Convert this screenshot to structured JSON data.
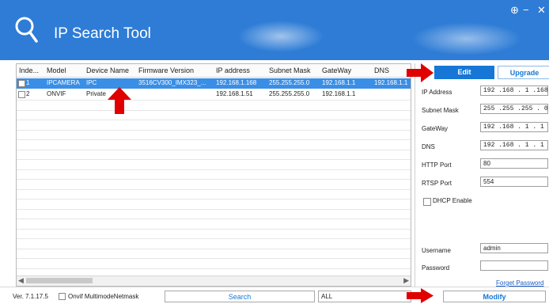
{
  "header": {
    "title": "IP Search Tool",
    "settings_label": "⊕",
    "minimize_label": "−",
    "close_label": "✕"
  },
  "table": {
    "columns": [
      "Inde...",
      "Model",
      "Device Name",
      "Firmware Version",
      "IP address",
      "Subnet Mask",
      "GateWay",
      "DNS"
    ],
    "rows": [
      {
        "index": "1",
        "model": "IPCAMERA",
        "device_name": "IPC",
        "firmware": "3516CV300_IMX323_...",
        "ip": "192.168.1.168",
        "mask": "255.255.255.0",
        "gateway": "192.168.1.1",
        "dns": "192.168.1.1",
        "selected": true
      },
      {
        "index": "2",
        "model": "ONVIF",
        "device_name": "Private",
        "firmware": "",
        "ip": "192.168.1.51",
        "mask": "255.255.255.0",
        "gateway": "192.168.1.1",
        "dns": "",
        "selected": false
      }
    ]
  },
  "panel": {
    "tab_edit": "Edit",
    "tab_upgrade": "Upgrade",
    "ip_label": "IP Address",
    "ip_value": "192 .168 . 1 .168",
    "mask_label": "Subnet Mask",
    "mask_value": "255 .255 .255 . 0",
    "gateway_label": "GateWay",
    "gateway_value": "192 .168 . 1 . 1",
    "dns_label": "DNS",
    "dns_value": "192 .168 . 1 . 1",
    "http_label": "HTTP Port",
    "http_value": "80",
    "rtsp_label": "RTSP Port",
    "rtsp_value": "554",
    "dhcp_label": "DHCP Enable",
    "username_label": "Username",
    "username_value": "admin",
    "password_label": "Password",
    "password_value": "",
    "forget_password": "Forget Password"
  },
  "bottom": {
    "version": "Ver. 7.1.17.5",
    "multimode_label": "Onvif MultimodeNetmask",
    "search_button": "Search",
    "filter_value": "ALL",
    "modify_button": "Modify"
  },
  "colors": {
    "header_blue": "#2e7cd6",
    "selection_blue": "#3a8ee6",
    "accent_blue": "#1677d6",
    "arrow_red": "#e00000"
  }
}
